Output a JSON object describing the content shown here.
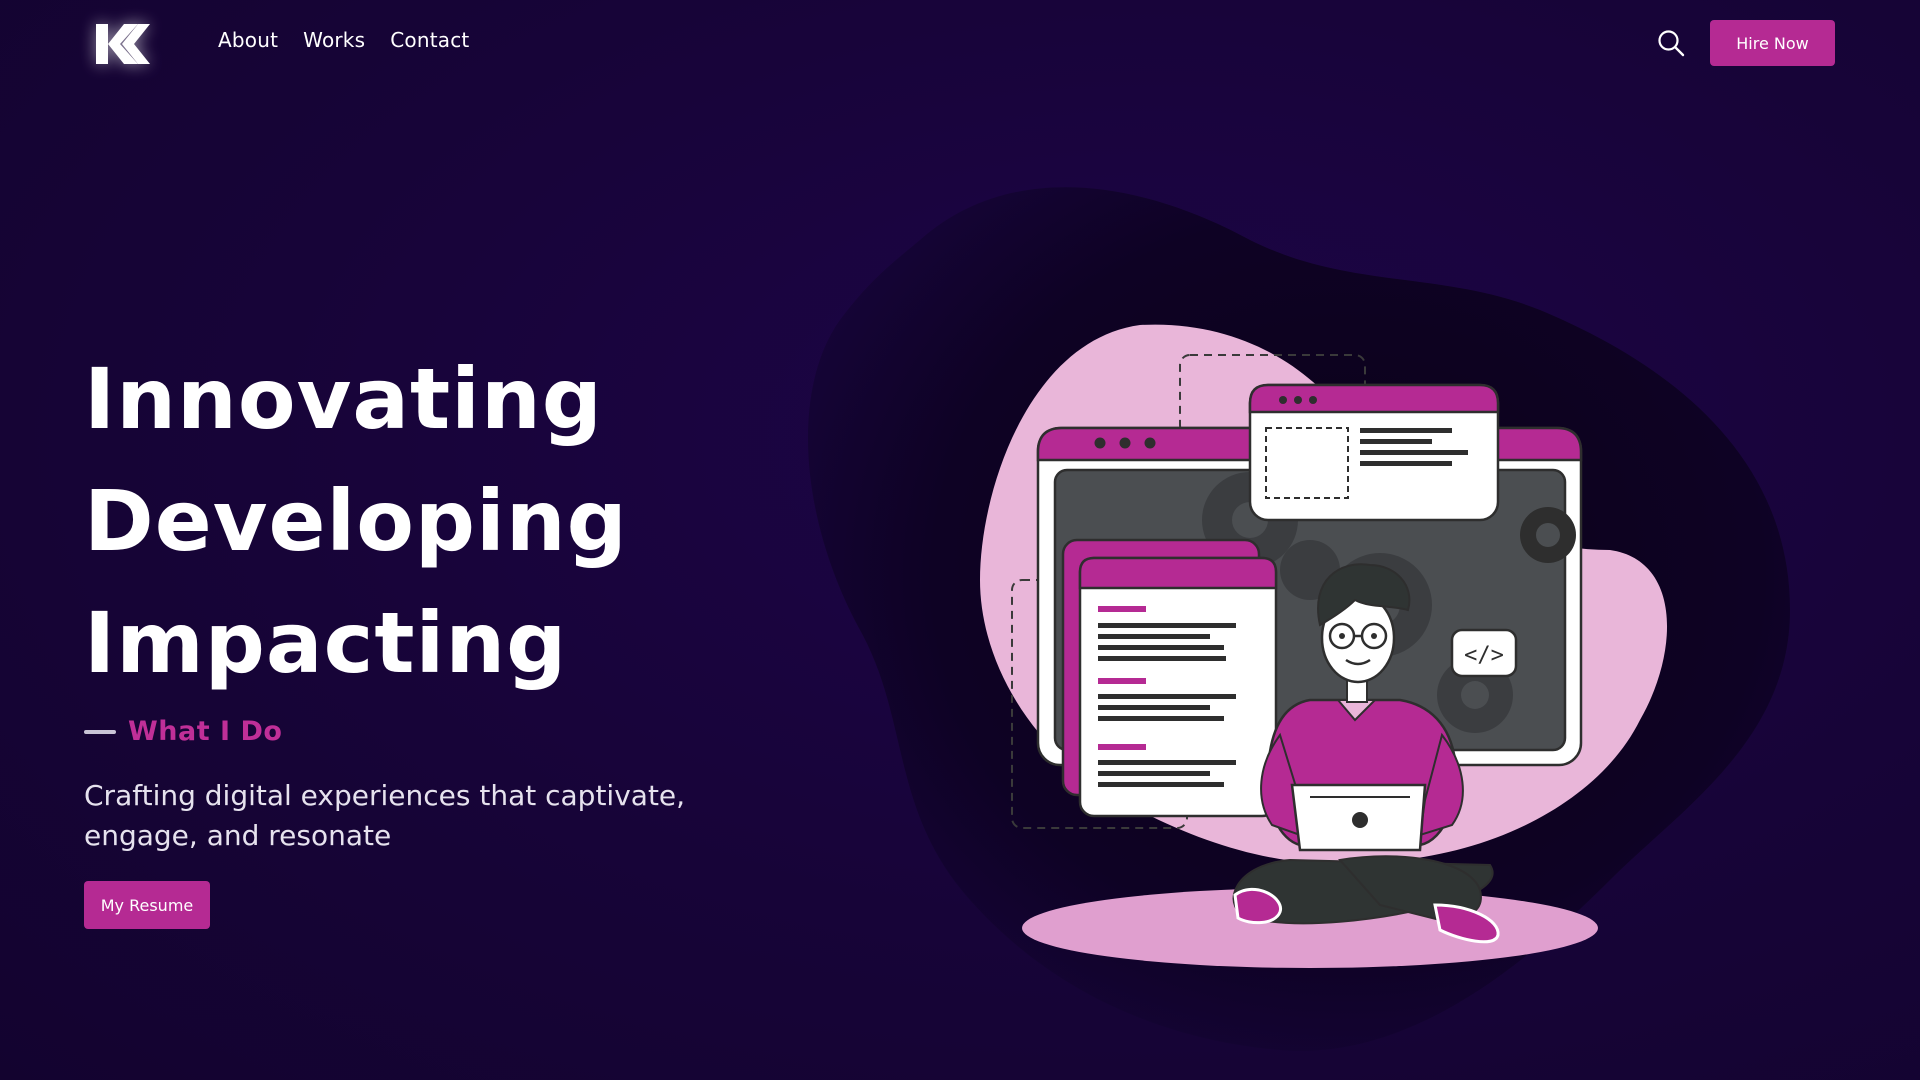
{
  "logo": {
    "text": "K",
    "alt": "K logo"
  },
  "nav": {
    "items": [
      "About",
      "Works",
      "Contact"
    ]
  },
  "header": {
    "search_icon": "search-icon",
    "hire_label": "Hire Now"
  },
  "hero": {
    "headline": [
      "Innovating",
      "Developing",
      "Impacting"
    ],
    "section_label": "What I Do",
    "tagline_line1": "Crafting digital experiences that captivate,",
    "tagline_line2": "engage, and resonate",
    "resume_label": "My Resume"
  },
  "illustration": {
    "code_tag": "</>",
    "description_icon": "developer-illustration"
  },
  "colors": {
    "background": "#170438",
    "accent": "#b52a93",
    "accent_light": "#e9b6d9",
    "blob_dark": "#0c0220",
    "text": "#ffffff"
  }
}
